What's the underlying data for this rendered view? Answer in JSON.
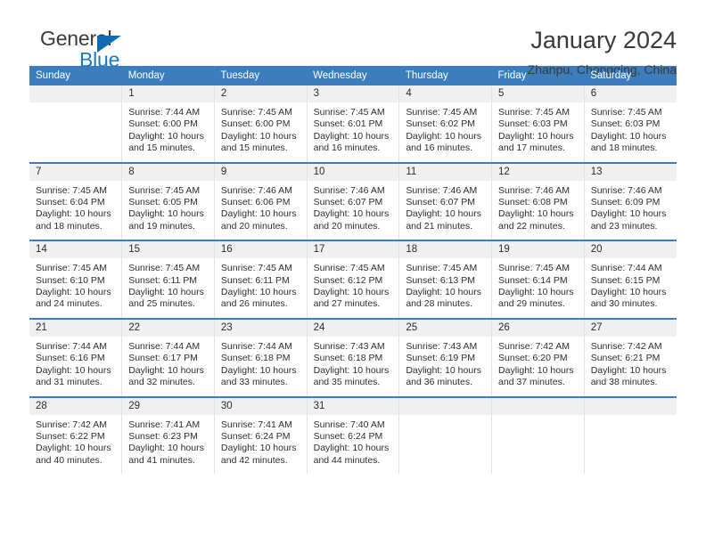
{
  "brand": {
    "name_part1": "General",
    "name_part2": "Blue",
    "triangle_color": "#1269b0",
    "blue_color": "#1a7bc4",
    "gray_color": "#3b3b3b"
  },
  "header": {
    "title": "January 2024",
    "subtitle": "Zhanpu, Chongqing, China",
    "accent_color": "#3c7ebd",
    "daynum_band_color": "#f0f0f0"
  },
  "weekday_headers": [
    "Sunday",
    "Monday",
    "Tuesday",
    "Wednesday",
    "Thursday",
    "Friday",
    "Saturday"
  ],
  "weeks": [
    [
      {
        "day": "",
        "lines": [
          "",
          "",
          "",
          ""
        ]
      },
      {
        "day": "1",
        "lines": [
          "Sunrise: 7:44 AM",
          "Sunset: 6:00 PM",
          "Daylight: 10 hours",
          "and 15 minutes."
        ]
      },
      {
        "day": "2",
        "lines": [
          "Sunrise: 7:45 AM",
          "Sunset: 6:00 PM",
          "Daylight: 10 hours",
          "and 15 minutes."
        ]
      },
      {
        "day": "3",
        "lines": [
          "Sunrise: 7:45 AM",
          "Sunset: 6:01 PM",
          "Daylight: 10 hours",
          "and 16 minutes."
        ]
      },
      {
        "day": "4",
        "lines": [
          "Sunrise: 7:45 AM",
          "Sunset: 6:02 PM",
          "Daylight: 10 hours",
          "and 16 minutes."
        ]
      },
      {
        "day": "5",
        "lines": [
          "Sunrise: 7:45 AM",
          "Sunset: 6:03 PM",
          "Daylight: 10 hours",
          "and 17 minutes."
        ]
      },
      {
        "day": "6",
        "lines": [
          "Sunrise: 7:45 AM",
          "Sunset: 6:03 PM",
          "Daylight: 10 hours",
          "and 18 minutes."
        ]
      }
    ],
    [
      {
        "day": "7",
        "lines": [
          "Sunrise: 7:45 AM",
          "Sunset: 6:04 PM",
          "Daylight: 10 hours",
          "and 18 minutes."
        ]
      },
      {
        "day": "8",
        "lines": [
          "Sunrise: 7:45 AM",
          "Sunset: 6:05 PM",
          "Daylight: 10 hours",
          "and 19 minutes."
        ]
      },
      {
        "day": "9",
        "lines": [
          "Sunrise: 7:46 AM",
          "Sunset: 6:06 PM",
          "Daylight: 10 hours",
          "and 20 minutes."
        ]
      },
      {
        "day": "10",
        "lines": [
          "Sunrise: 7:46 AM",
          "Sunset: 6:07 PM",
          "Daylight: 10 hours",
          "and 20 minutes."
        ]
      },
      {
        "day": "11",
        "lines": [
          "Sunrise: 7:46 AM",
          "Sunset: 6:07 PM",
          "Daylight: 10 hours",
          "and 21 minutes."
        ]
      },
      {
        "day": "12",
        "lines": [
          "Sunrise: 7:46 AM",
          "Sunset: 6:08 PM",
          "Daylight: 10 hours",
          "and 22 minutes."
        ]
      },
      {
        "day": "13",
        "lines": [
          "Sunrise: 7:46 AM",
          "Sunset: 6:09 PM",
          "Daylight: 10 hours",
          "and 23 minutes."
        ]
      }
    ],
    [
      {
        "day": "14",
        "lines": [
          "Sunrise: 7:45 AM",
          "Sunset: 6:10 PM",
          "Daylight: 10 hours",
          "and 24 minutes."
        ]
      },
      {
        "day": "15",
        "lines": [
          "Sunrise: 7:45 AM",
          "Sunset: 6:11 PM",
          "Daylight: 10 hours",
          "and 25 minutes."
        ]
      },
      {
        "day": "16",
        "lines": [
          "Sunrise: 7:45 AM",
          "Sunset: 6:11 PM",
          "Daylight: 10 hours",
          "and 26 minutes."
        ]
      },
      {
        "day": "17",
        "lines": [
          "Sunrise: 7:45 AM",
          "Sunset: 6:12 PM",
          "Daylight: 10 hours",
          "and 27 minutes."
        ]
      },
      {
        "day": "18",
        "lines": [
          "Sunrise: 7:45 AM",
          "Sunset: 6:13 PM",
          "Daylight: 10 hours",
          "and 28 minutes."
        ]
      },
      {
        "day": "19",
        "lines": [
          "Sunrise: 7:45 AM",
          "Sunset: 6:14 PM",
          "Daylight: 10 hours",
          "and 29 minutes."
        ]
      },
      {
        "day": "20",
        "lines": [
          "Sunrise: 7:44 AM",
          "Sunset: 6:15 PM",
          "Daylight: 10 hours",
          "and 30 minutes."
        ]
      }
    ],
    [
      {
        "day": "21",
        "lines": [
          "Sunrise: 7:44 AM",
          "Sunset: 6:16 PM",
          "Daylight: 10 hours",
          "and 31 minutes."
        ]
      },
      {
        "day": "22",
        "lines": [
          "Sunrise: 7:44 AM",
          "Sunset: 6:17 PM",
          "Daylight: 10 hours",
          "and 32 minutes."
        ]
      },
      {
        "day": "23",
        "lines": [
          "Sunrise: 7:44 AM",
          "Sunset: 6:18 PM",
          "Daylight: 10 hours",
          "and 33 minutes."
        ]
      },
      {
        "day": "24",
        "lines": [
          "Sunrise: 7:43 AM",
          "Sunset: 6:18 PM",
          "Daylight: 10 hours",
          "and 35 minutes."
        ]
      },
      {
        "day": "25",
        "lines": [
          "Sunrise: 7:43 AM",
          "Sunset: 6:19 PM",
          "Daylight: 10 hours",
          "and 36 minutes."
        ]
      },
      {
        "day": "26",
        "lines": [
          "Sunrise: 7:42 AM",
          "Sunset: 6:20 PM",
          "Daylight: 10 hours",
          "and 37 minutes."
        ]
      },
      {
        "day": "27",
        "lines": [
          "Sunrise: 7:42 AM",
          "Sunset: 6:21 PM",
          "Daylight: 10 hours",
          "and 38 minutes."
        ]
      }
    ],
    [
      {
        "day": "28",
        "lines": [
          "Sunrise: 7:42 AM",
          "Sunset: 6:22 PM",
          "Daylight: 10 hours",
          "and 40 minutes."
        ]
      },
      {
        "day": "29",
        "lines": [
          "Sunrise: 7:41 AM",
          "Sunset: 6:23 PM",
          "Daylight: 10 hours",
          "and 41 minutes."
        ]
      },
      {
        "day": "30",
        "lines": [
          "Sunrise: 7:41 AM",
          "Sunset: 6:24 PM",
          "Daylight: 10 hours",
          "and 42 minutes."
        ]
      },
      {
        "day": "31",
        "lines": [
          "Sunrise: 7:40 AM",
          "Sunset: 6:24 PM",
          "Daylight: 10 hours",
          "and 44 minutes."
        ]
      },
      {
        "day": "",
        "lines": [
          "",
          "",
          "",
          ""
        ]
      },
      {
        "day": "",
        "lines": [
          "",
          "",
          "",
          ""
        ]
      },
      {
        "day": "",
        "lines": [
          "",
          "",
          "",
          ""
        ]
      }
    ]
  ]
}
